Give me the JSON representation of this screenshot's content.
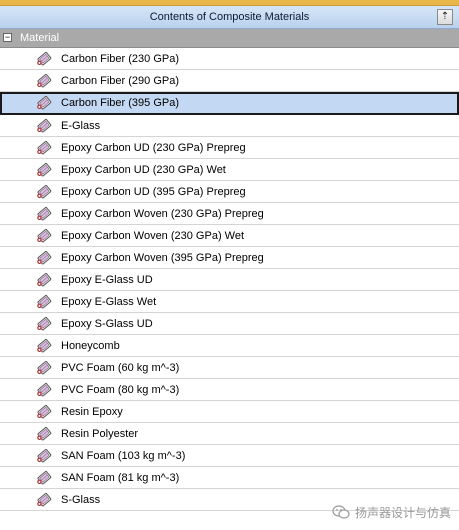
{
  "panel": {
    "title": "Contents of Composite Materials",
    "pin_icon": "pin-icon"
  },
  "group": {
    "label": "Material",
    "expanded": true
  },
  "materials": [
    {
      "label": "Carbon Fiber (230 GPa)",
      "selected": false
    },
    {
      "label": "Carbon Fiber (290 GPa)",
      "selected": false
    },
    {
      "label": "Carbon Fiber (395 GPa)",
      "selected": true
    },
    {
      "label": "E-Glass",
      "selected": false
    },
    {
      "label": "Epoxy Carbon UD (230 GPa) Prepreg",
      "selected": false
    },
    {
      "label": "Epoxy Carbon UD (230 GPa) Wet",
      "selected": false
    },
    {
      "label": "Epoxy Carbon UD (395 GPa) Prepreg",
      "selected": false
    },
    {
      "label": "Epoxy Carbon Woven (230 GPa) Prepreg",
      "selected": false
    },
    {
      "label": "Epoxy Carbon Woven (230 GPa) Wet",
      "selected": false
    },
    {
      "label": "Epoxy Carbon Woven (395 GPa) Prepreg",
      "selected": false
    },
    {
      "label": "Epoxy E-Glass UD",
      "selected": false
    },
    {
      "label": "Epoxy E-Glass Wet",
      "selected": false
    },
    {
      "label": "Epoxy S-Glass UD",
      "selected": false
    },
    {
      "label": "Honeycomb",
      "selected": false
    },
    {
      "label": "PVC Foam (60 kg m^-3)",
      "selected": false
    },
    {
      "label": "PVC Foam (80 kg m^-3)",
      "selected": false
    },
    {
      "label": "Resin Epoxy",
      "selected": false
    },
    {
      "label": "Resin Polyester",
      "selected": false
    },
    {
      "label": "SAN Foam (103 kg m^-3)",
      "selected": false
    },
    {
      "label": "SAN Foam (81 kg m^-3)",
      "selected": false
    },
    {
      "label": "S-Glass",
      "selected": false
    }
  ],
  "material_icon": "material-tag-icon",
  "watermark": {
    "text": "扬声器设计与仿真",
    "icon": "wechat-icon"
  },
  "colors": {
    "title_bar": "#b9d1ee",
    "group_header": "#a9a9a9",
    "selected_row": "#c3d8f3",
    "accent": "#e9b64a"
  }
}
